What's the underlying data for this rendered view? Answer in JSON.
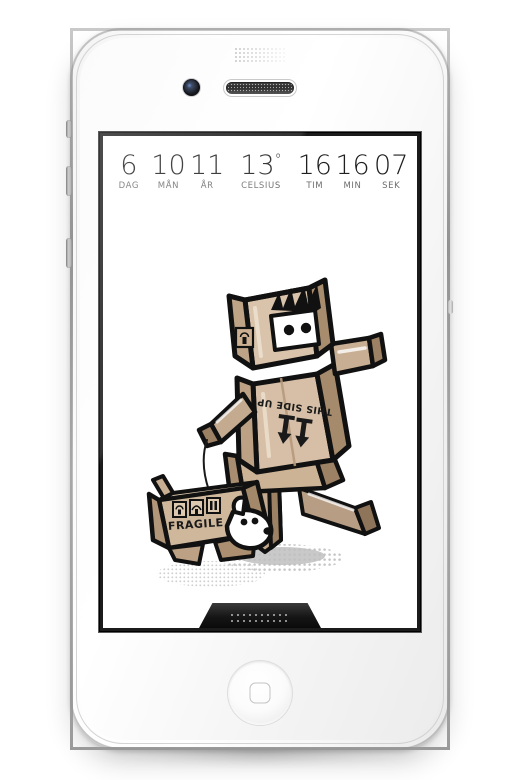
{
  "device": {
    "name": "iPhone 4 white",
    "hardware": {
      "front_camera": "front-camera",
      "earpiece": "earpiece-speaker",
      "sensor": "proximity-sensor",
      "home_button": "home-button",
      "volume_up": "volume-up-button",
      "volume_down": "volume-down-button",
      "mute_switch": "mute-switch"
    }
  },
  "screen": {
    "background_color": "#ffffff",
    "clock": {
      "cells": [
        {
          "value": "6",
          "label": "DAG",
          "degree": false
        },
        {
          "value": "10",
          "label": "MÅN",
          "degree": false
        },
        {
          "value": "11",
          "label": "ÅR",
          "degree": false
        },
        {
          "value": "13",
          "label": "CELSIUS",
          "degree": true
        },
        {
          "value": "16",
          "label": "TIM",
          "degree": false
        },
        {
          "value": "16",
          "label": "MIN",
          "degree": false
        },
        {
          "value": "07",
          "label": "SEK",
          "degree": false
        }
      ],
      "degree_symbol": "°",
      "text_color": "#1f1f1f",
      "label_color": "#6d6d6d"
    },
    "illustration": {
      "title": "cardboard-box-robot-walking-box-dog",
      "robot": {
        "name": "box-robot",
        "head_label": "fragile-symbol",
        "torso_text": "THIS SIDE UP",
        "torso_text_rotated": true,
        "arrows": "two-down-arrows",
        "eyes": 2,
        "hair": "spiky-black-hair"
      },
      "dog": {
        "name": "box-dog",
        "box_text": "FRAGILE",
        "symbols": [
          "umbrella-symbol",
          "glass-symbol",
          "this-side-up-symbol"
        ],
        "leash": "leash-string"
      },
      "colors": {
        "cardboard_light": "#e9dfd2",
        "cardboard_mid": "#c5ac92",
        "cardboard_dark": "#9a7f63",
        "cardboard_shade": "#7d6349",
        "outline": "#111111",
        "white": "#ffffff",
        "shadow_dot": "#c9c9c9"
      }
    },
    "dock": {
      "name": "bottom-speaker-dock",
      "grille": "speaker-grille"
    }
  }
}
